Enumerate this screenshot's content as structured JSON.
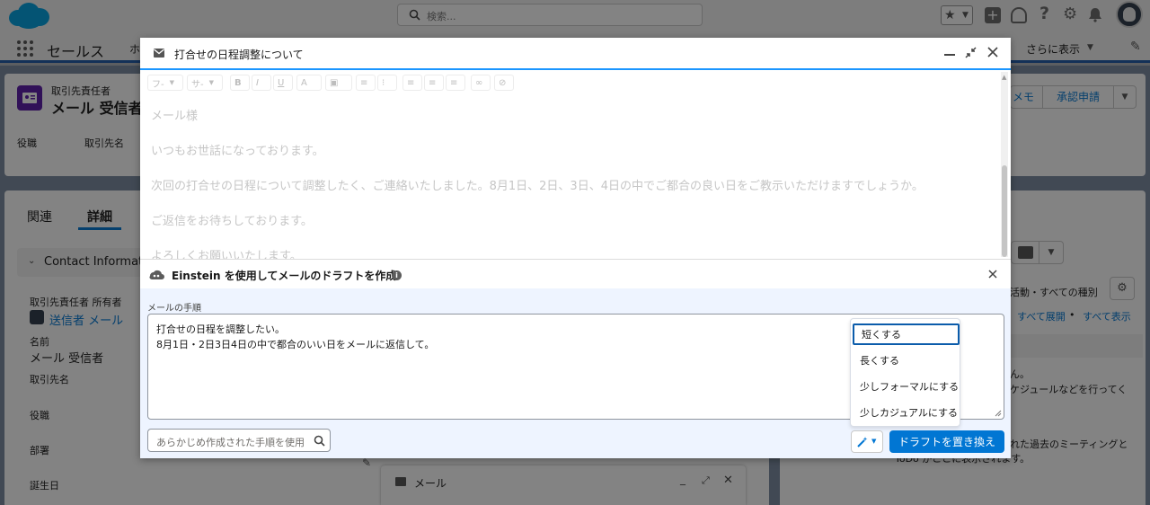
{
  "global_header": {
    "search_placeholder": "検索..."
  },
  "app_nav": {
    "app_name": "セールス",
    "tab_partial": "ホ",
    "more_label": "さらに表示"
  },
  "record": {
    "object_label": "取引先責任者",
    "name": "メール 受信者",
    "fields_compact": [
      "役職",
      "取引先名"
    ],
    "actions": [
      "メモ",
      "承認申請"
    ]
  },
  "detail": {
    "tabs": [
      "関連",
      "詳細"
    ],
    "section_title": "Contact Informati",
    "owner_label": "取引先責任者 所有者",
    "owner_value": "送信者 メール",
    "name_label": "名前",
    "name_value": "メール 受信者",
    "account_label": "取引先名",
    "title_label": "役職",
    "dept_label": "部署",
    "birthday_label": "誕生日"
  },
  "activity": {
    "filter_text": "活動・すべての種別",
    "expand_all": "すべて展開",
    "show_all": "すべて表示",
    "text1": "ん。",
    "text2": "ケジュールなどを行ってく",
    "text3": "れた過去のミーティングと",
    "text4": "ToDo がここに表示されます。"
  },
  "docked_email": {
    "title": "メール"
  },
  "modal": {
    "title": "打合せの日程調整について",
    "toolbar": {
      "font_label": "フ-",
      "size_label": "サ-"
    },
    "body_lines": [
      "メール様",
      "いつもお世話になっております。",
      "次回の打合せの日程について調整したく、ご連絡いたしました。8月1日、2日、3日、4日の中でご都合の良い日をご教示いただけますでしょうか。",
      "ご返信をお待ちしております。",
      "よろしくお願いいたします。"
    ]
  },
  "einstein": {
    "title": "Einstein を使用してメールのドラフトを作成",
    "instruction_label": "メールの手順",
    "instruction_lines": [
      "打合せの日程を調整したい。",
      "8月1日・2日3日4日の中で都合のいい日をメールに返信して。"
    ],
    "template_search_placeholder": "あらかじめ作成された手順を使用",
    "replace_button": "ドラフトを置き換え",
    "menu_items": [
      "短くする",
      "長くする",
      "少しフォーマルにする",
      "少しカジュアルにする"
    ],
    "selected_index": 0
  },
  "colors": {
    "brand_blue": "#0176d3",
    "cloud_blue": "#00a1e0",
    "contact_purple": "#5a1ba9",
    "focus_border": "#0b5cab"
  }
}
